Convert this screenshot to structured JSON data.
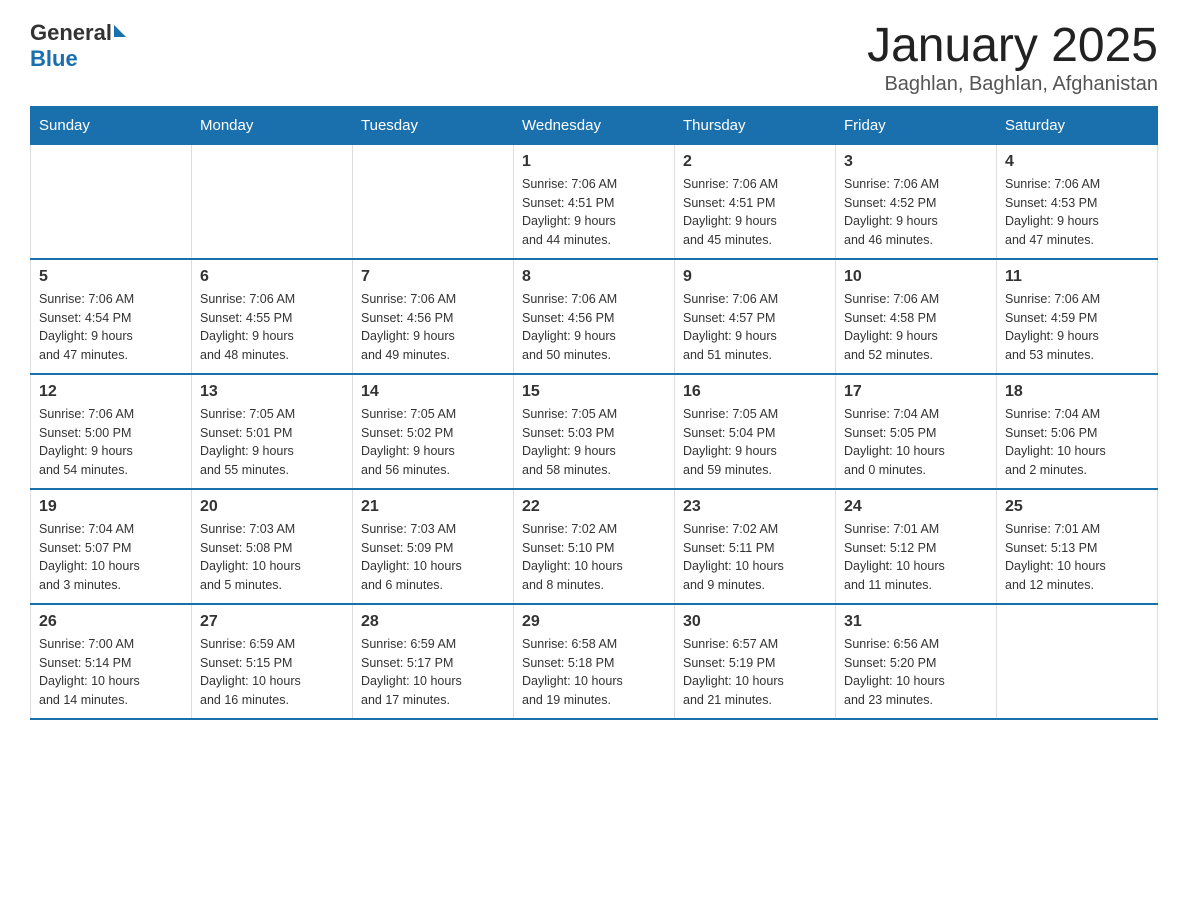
{
  "logo": {
    "general": "General",
    "blue": "Blue"
  },
  "title": "January 2025",
  "subtitle": "Baghlan, Baghlan, Afghanistan",
  "weekdays": [
    "Sunday",
    "Monday",
    "Tuesday",
    "Wednesday",
    "Thursday",
    "Friday",
    "Saturday"
  ],
  "weeks": [
    [
      {
        "day": "",
        "info": ""
      },
      {
        "day": "",
        "info": ""
      },
      {
        "day": "",
        "info": ""
      },
      {
        "day": "1",
        "info": "Sunrise: 7:06 AM\nSunset: 4:51 PM\nDaylight: 9 hours\nand 44 minutes."
      },
      {
        "day": "2",
        "info": "Sunrise: 7:06 AM\nSunset: 4:51 PM\nDaylight: 9 hours\nand 45 minutes."
      },
      {
        "day": "3",
        "info": "Sunrise: 7:06 AM\nSunset: 4:52 PM\nDaylight: 9 hours\nand 46 minutes."
      },
      {
        "day": "4",
        "info": "Sunrise: 7:06 AM\nSunset: 4:53 PM\nDaylight: 9 hours\nand 47 minutes."
      }
    ],
    [
      {
        "day": "5",
        "info": "Sunrise: 7:06 AM\nSunset: 4:54 PM\nDaylight: 9 hours\nand 47 minutes."
      },
      {
        "day": "6",
        "info": "Sunrise: 7:06 AM\nSunset: 4:55 PM\nDaylight: 9 hours\nand 48 minutes."
      },
      {
        "day": "7",
        "info": "Sunrise: 7:06 AM\nSunset: 4:56 PM\nDaylight: 9 hours\nand 49 minutes."
      },
      {
        "day": "8",
        "info": "Sunrise: 7:06 AM\nSunset: 4:56 PM\nDaylight: 9 hours\nand 50 minutes."
      },
      {
        "day": "9",
        "info": "Sunrise: 7:06 AM\nSunset: 4:57 PM\nDaylight: 9 hours\nand 51 minutes."
      },
      {
        "day": "10",
        "info": "Sunrise: 7:06 AM\nSunset: 4:58 PM\nDaylight: 9 hours\nand 52 minutes."
      },
      {
        "day": "11",
        "info": "Sunrise: 7:06 AM\nSunset: 4:59 PM\nDaylight: 9 hours\nand 53 minutes."
      }
    ],
    [
      {
        "day": "12",
        "info": "Sunrise: 7:06 AM\nSunset: 5:00 PM\nDaylight: 9 hours\nand 54 minutes."
      },
      {
        "day": "13",
        "info": "Sunrise: 7:05 AM\nSunset: 5:01 PM\nDaylight: 9 hours\nand 55 minutes."
      },
      {
        "day": "14",
        "info": "Sunrise: 7:05 AM\nSunset: 5:02 PM\nDaylight: 9 hours\nand 56 minutes."
      },
      {
        "day": "15",
        "info": "Sunrise: 7:05 AM\nSunset: 5:03 PM\nDaylight: 9 hours\nand 58 minutes."
      },
      {
        "day": "16",
        "info": "Sunrise: 7:05 AM\nSunset: 5:04 PM\nDaylight: 9 hours\nand 59 minutes."
      },
      {
        "day": "17",
        "info": "Sunrise: 7:04 AM\nSunset: 5:05 PM\nDaylight: 10 hours\nand 0 minutes."
      },
      {
        "day": "18",
        "info": "Sunrise: 7:04 AM\nSunset: 5:06 PM\nDaylight: 10 hours\nand 2 minutes."
      }
    ],
    [
      {
        "day": "19",
        "info": "Sunrise: 7:04 AM\nSunset: 5:07 PM\nDaylight: 10 hours\nand 3 minutes."
      },
      {
        "day": "20",
        "info": "Sunrise: 7:03 AM\nSunset: 5:08 PM\nDaylight: 10 hours\nand 5 minutes."
      },
      {
        "day": "21",
        "info": "Sunrise: 7:03 AM\nSunset: 5:09 PM\nDaylight: 10 hours\nand 6 minutes."
      },
      {
        "day": "22",
        "info": "Sunrise: 7:02 AM\nSunset: 5:10 PM\nDaylight: 10 hours\nand 8 minutes."
      },
      {
        "day": "23",
        "info": "Sunrise: 7:02 AM\nSunset: 5:11 PM\nDaylight: 10 hours\nand 9 minutes."
      },
      {
        "day": "24",
        "info": "Sunrise: 7:01 AM\nSunset: 5:12 PM\nDaylight: 10 hours\nand 11 minutes."
      },
      {
        "day": "25",
        "info": "Sunrise: 7:01 AM\nSunset: 5:13 PM\nDaylight: 10 hours\nand 12 minutes."
      }
    ],
    [
      {
        "day": "26",
        "info": "Sunrise: 7:00 AM\nSunset: 5:14 PM\nDaylight: 10 hours\nand 14 minutes."
      },
      {
        "day": "27",
        "info": "Sunrise: 6:59 AM\nSunset: 5:15 PM\nDaylight: 10 hours\nand 16 minutes."
      },
      {
        "day": "28",
        "info": "Sunrise: 6:59 AM\nSunset: 5:17 PM\nDaylight: 10 hours\nand 17 minutes."
      },
      {
        "day": "29",
        "info": "Sunrise: 6:58 AM\nSunset: 5:18 PM\nDaylight: 10 hours\nand 19 minutes."
      },
      {
        "day": "30",
        "info": "Sunrise: 6:57 AM\nSunset: 5:19 PM\nDaylight: 10 hours\nand 21 minutes."
      },
      {
        "day": "31",
        "info": "Sunrise: 6:56 AM\nSunset: 5:20 PM\nDaylight: 10 hours\nand 23 minutes."
      },
      {
        "day": "",
        "info": ""
      }
    ]
  ]
}
